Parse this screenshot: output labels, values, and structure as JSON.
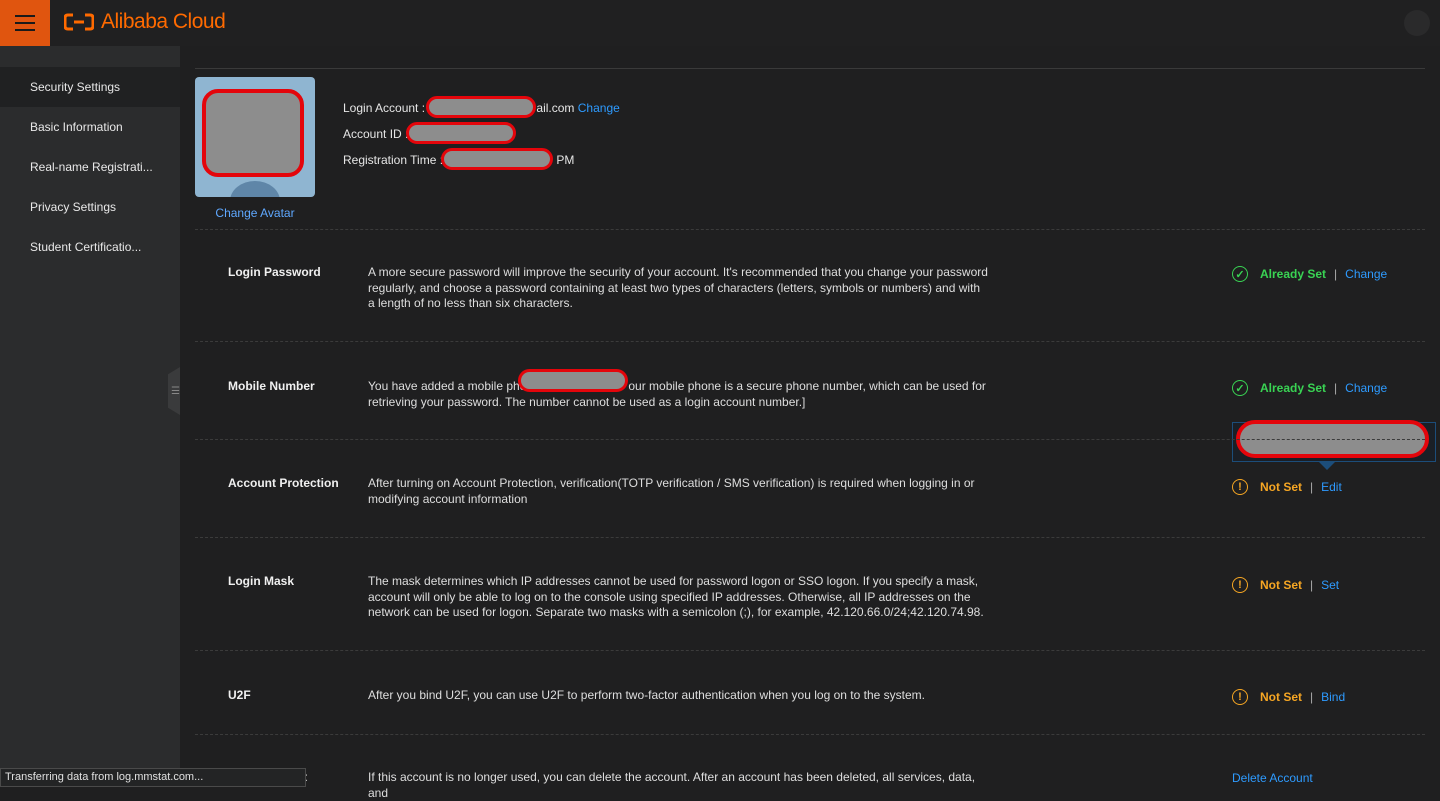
{
  "topbar": {
    "brand": "Alibaba Cloud"
  },
  "sidebar": {
    "items": [
      {
        "label": "Security Settings"
      },
      {
        "label": "Basic Information"
      },
      {
        "label": "Real-name Registrati..."
      },
      {
        "label": "Privacy Settings"
      },
      {
        "label": "Student Certificatio..."
      }
    ]
  },
  "profile": {
    "change_avatar": "Change Avatar",
    "login_account_label": "Login Account :",
    "login_account_suffix": "ail.com",
    "login_account_change": "Change",
    "account_id_label": "Account ID :",
    "registration_time_label": "Registration Time :",
    "registration_time_suffix": "PM"
  },
  "settings": [
    {
      "title": "Login Password",
      "desc": "A more secure password will improve the security of your account. It's recommended that you change your password regularly, and choose a password containing at least two types of characters (letters, symbols or numbers) and with a length of no less than six characters.",
      "status": "Already Set",
      "action": "Change"
    },
    {
      "title": "Mobile Number",
      "desc_before": "You have added a mobile pho",
      "desc_after": "our mobile phone is a secure phone number, which can be used for retrieving your password. The number cannot be used as a login account number.]",
      "status": "Already Set",
      "action": "Change"
    },
    {
      "title": "Account Protection",
      "desc": "After turning on Account Protection, verification(TOTP verification / SMS verification) is required when logging in or modifying account information",
      "status": "Not Set",
      "action": "Edit"
    },
    {
      "title": "Login Mask",
      "desc": "The mask determines which IP addresses cannot be used for password logon or SSO logon. If you specify a mask, account will only be able to log on to the console using specified IP addresses. Otherwise, all IP addresses on the network can be used for logon. Separate two masks with a semicolon (;), for example, 42.120.66.0/24;42.120.74.98.",
      "status": "Not Set",
      "action": "Set"
    },
    {
      "title": "U2F",
      "desc": "After you bind U2F, you can use U2F to perform two-factor authentication when you log on to the system.",
      "status": "Not Set",
      "action": "Bind"
    },
    {
      "title": "t",
      "desc": "If this account is no longer used, you can delete the account. After an account has been deleted, all services, data, and",
      "action": "Delete Account"
    }
  ],
  "browser_status": "Transferring data from log.mmstat.com...",
  "colors": {
    "accent": "#ff6a00",
    "link": "#2e9bff",
    "ok": "#39d353",
    "warn": "#f6a623",
    "redaction_border": "#e4050b"
  }
}
